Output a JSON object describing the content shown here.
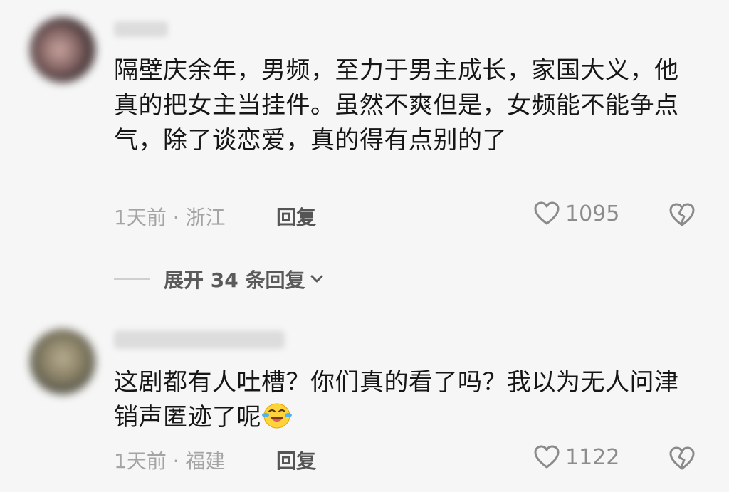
{
  "comments": [
    {
      "text": "隔壁庆余年，男频，至力于男主成长，家国大义，他真的把女主当挂件。虽然不爽但是，女频能不能争点气，除了谈恋爱，真的得有点别的了",
      "meta": "1天前 · 浙江",
      "reply_label": "回复",
      "likes": "1095"
    },
    {
      "text": "这剧都有人吐槽？你们真的看了吗？我以为无人问津销声匿迹了呢",
      "emoji": "laughing-crying-emoji",
      "meta": "1天前 · 福建",
      "reply_label": "回复",
      "likes": "1122"
    }
  ],
  "expand_replies": {
    "label": "展开 34 条回复"
  },
  "icons": {
    "like": "heart-outline-icon",
    "dislike": "broken-heart-icon",
    "expand": "chevron-down-icon"
  }
}
